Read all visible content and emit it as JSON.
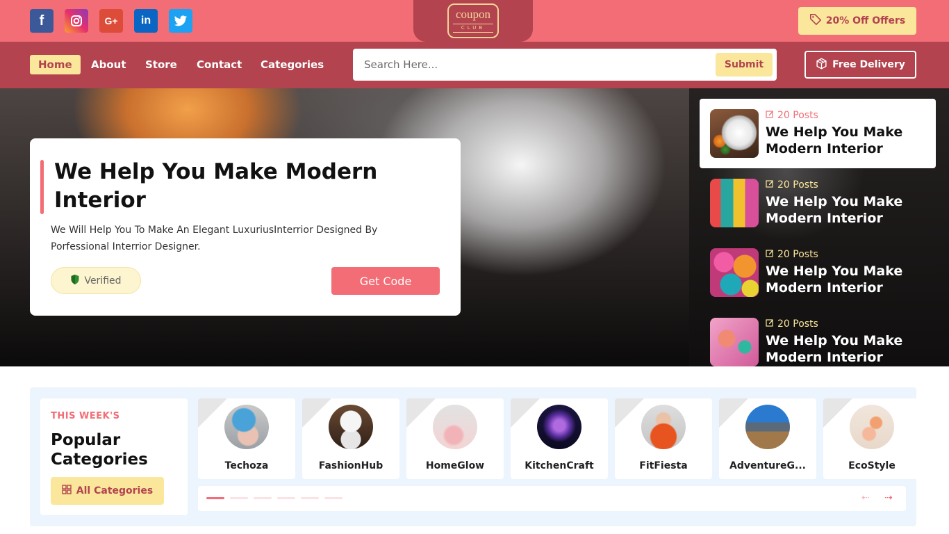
{
  "topbar": {
    "social": [
      {
        "name": "facebook",
        "glyph": "f"
      },
      {
        "name": "instagram",
        "glyph": "◎"
      },
      {
        "name": "google-plus",
        "glyph": "G+"
      },
      {
        "name": "linkedin",
        "glyph": "in"
      },
      {
        "name": "twitter",
        "glyph": "🐦"
      }
    ],
    "logo_text": "coupon",
    "logo_sub": "CLUB",
    "offers_label": "20% Off Offers"
  },
  "nav": {
    "items": [
      "Home",
      "About",
      "Store",
      "Contact",
      "Categories"
    ],
    "active": "Home",
    "search_placeholder": "Search Here...",
    "submit_label": "Submit",
    "delivery_label": "Free Delivery"
  },
  "hero": {
    "title": "We Help You Make Modern Interior",
    "description": "We Will Help You To Make An Elegant LuxuriusInterrior Designed By Porfessional Interrior Designer.",
    "verified_label": "Verified",
    "cta_label": "Get Code"
  },
  "posts": [
    {
      "count": "20 Posts",
      "title": "We Help You Make Modern Interior"
    },
    {
      "count": "20 Posts",
      "title": "We Help You Make Modern Interior"
    },
    {
      "count": "20 Posts",
      "title": "We Help You Make Modern Interior"
    },
    {
      "count": "20 Posts",
      "title": "We Help You Make Modern Interior"
    }
  ],
  "categories": {
    "eyebrow": "THIS WEEK'S",
    "title": "Popular Categories",
    "all_label": "All Categories",
    "items": [
      "Techoza",
      "FashionHub",
      "HomeGlow",
      "KitchenCraft",
      "FitFiesta",
      "AdventureG...",
      "EcoStyle"
    ]
  },
  "colors": {
    "primary": "#f26d75",
    "dark": "#b2434f",
    "accent": "#fbe79b"
  }
}
